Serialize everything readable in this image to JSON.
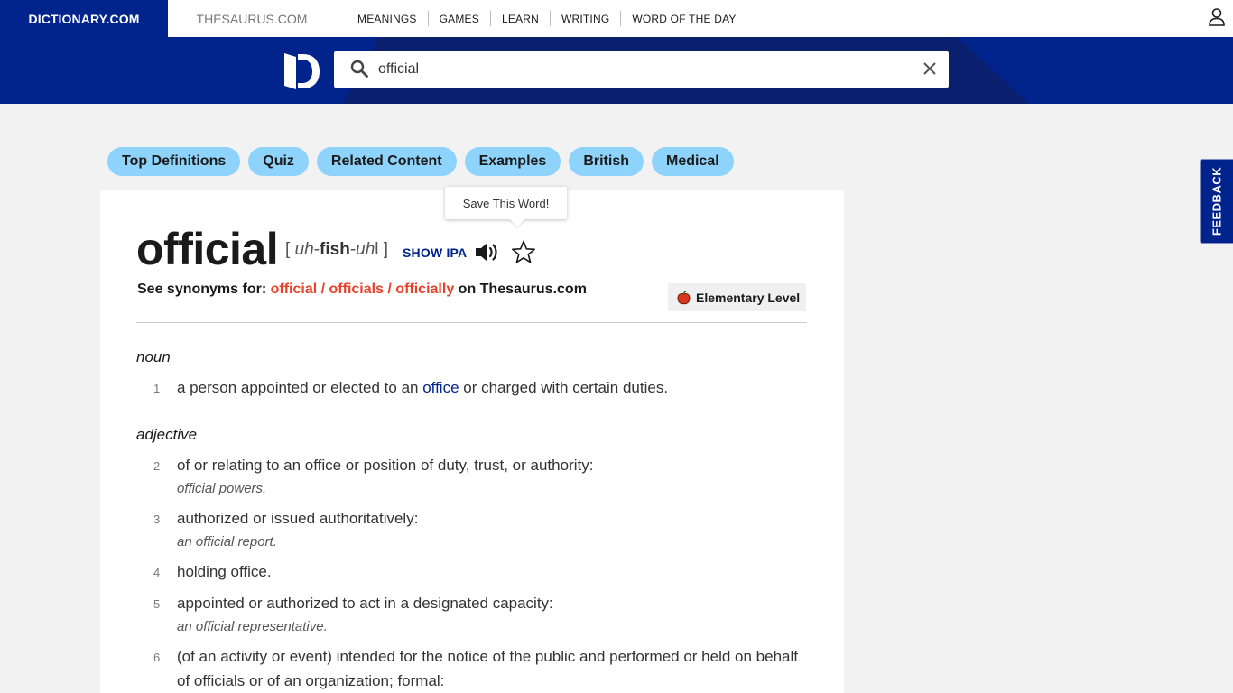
{
  "topnav": {
    "brand_dictionary": "DICTIONARY.COM",
    "brand_thesaurus": "THESAURUS.COM",
    "links": [
      "MEANINGS",
      "GAMES",
      "LEARN",
      "WRITING",
      "WORD OF THE DAY"
    ]
  },
  "search": {
    "value": "official"
  },
  "pills": [
    "Top Definitions",
    "Quiz",
    "Related Content",
    "Examples",
    "British",
    "Medical"
  ],
  "feedback": "FEEDBACK",
  "tooltip": "Save This Word!",
  "entry": {
    "headword": "official",
    "pron_open": "[ ",
    "pron_part1": "uh",
    "pron_part2": "-",
    "pron_part3": "fish",
    "pron_part4": "-",
    "pron_part5": "uh",
    "pron_part6": "l",
    "pron_close": " ]",
    "show_ipa": "SHOW IPA",
    "syn_prefix": "See synonyms for: ",
    "syn_links": "official / officials / officially",
    "syn_suffix": " on Thesaurus.com",
    "level": "Elementary Level"
  },
  "definitions": {
    "noun_label": "noun",
    "d1_num": "1",
    "d1_before": "a person appointed or elected to an ",
    "d1_link": "office",
    "d1_after": " or charged with certain duties.",
    "adj_label": "adjective",
    "d2_num": "2",
    "d2_text": "of or relating to an office or position of duty, trust, or authority:",
    "d2_example": "official powers.",
    "d3_num": "3",
    "d3_text": "authorized or issued authoritatively:",
    "d3_example": "an official report.",
    "d4_num": "4",
    "d4_text": "holding office.",
    "d5_num": "5",
    "d5_text": "appointed or authorized to act in a designated capacity:",
    "d5_example": "an official representative.",
    "d6_num": "6",
    "d6_text": "(of an activity or event) intended for the notice of the public and performed or held on behalf of officials or of an organization; formal:"
  },
  "colors": {
    "brand_blue": "#00248b",
    "pill_blue": "#8ed3fb",
    "synonym_red": "#e8422c"
  },
  "icons": [
    "user-icon",
    "dictionary-logo-icon",
    "search-icon",
    "clear-icon",
    "speaker-icon",
    "star-icon",
    "apple-icon"
  ]
}
